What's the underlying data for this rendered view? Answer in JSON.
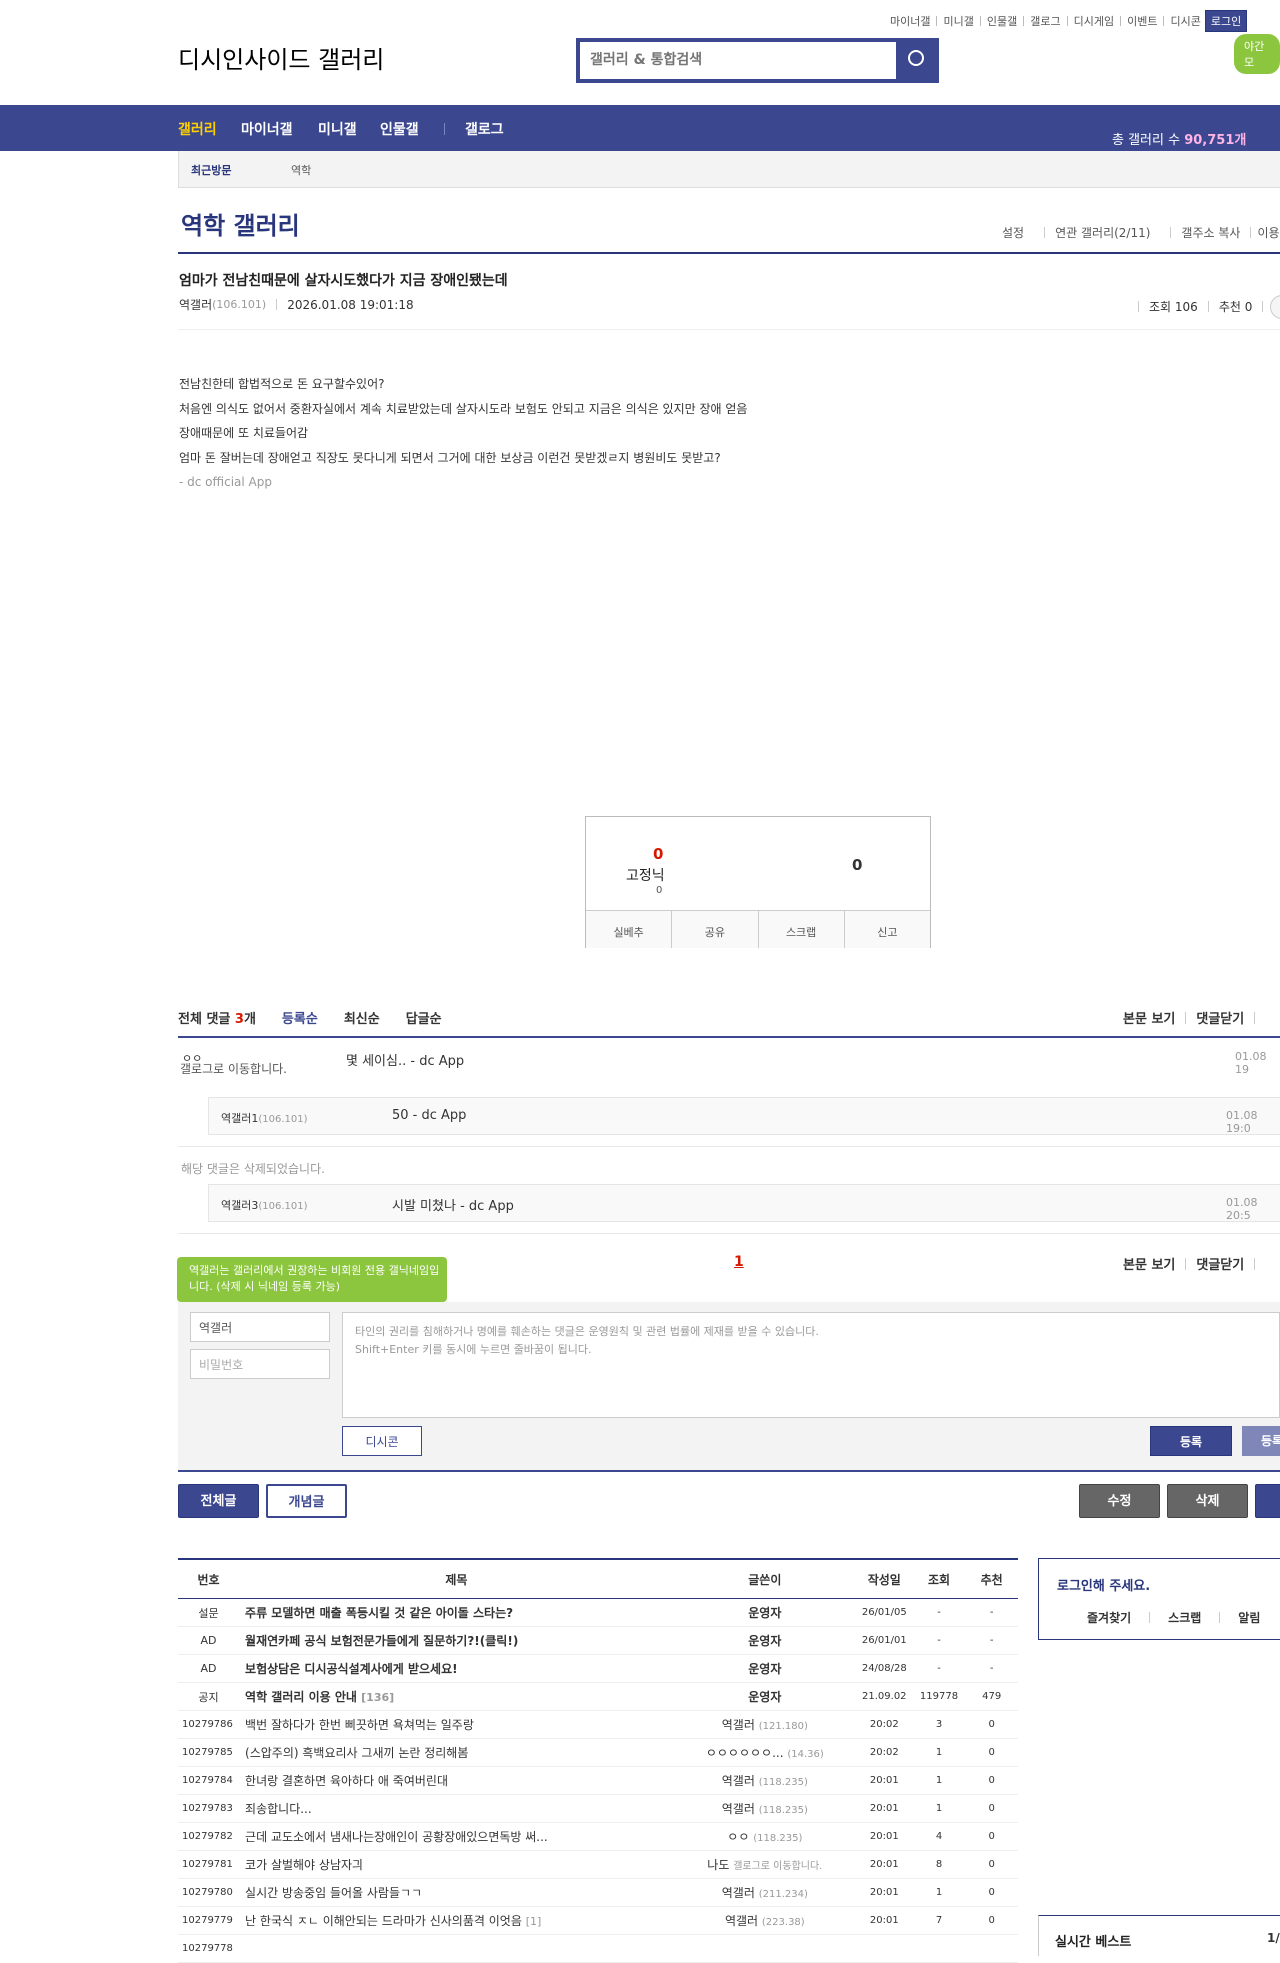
{
  "header": {
    "util_links": [
      "마이너갤",
      "미니갤",
      "인물갤",
      "갤로그",
      "디시게임",
      "이벤트",
      "디시콘"
    ],
    "login": "로그인",
    "night_mode": "야간 모",
    "logo_alt": "디시인사이드 갤러리",
    "search_placeholder": "갤러리 & 통합검색"
  },
  "nav": {
    "items": [
      "갤러리",
      "마이너갤",
      "미니갤",
      "인물갤",
      "갤로그"
    ],
    "count_label": "총 갤러리 수",
    "count_value": "90,751개"
  },
  "recent": {
    "label": "최근방문",
    "gallery": "역학"
  },
  "gallery": {
    "title": "역학 갤러리",
    "tools": [
      "설정",
      "연관 갤러리(2/11)",
      "갤주소 복사",
      "이용"
    ]
  },
  "post": {
    "title": "엄마가 전남친때문에 살자시도했다가 지금 장애인됐는데",
    "author": "역갤러",
    "ip": "(106.101)",
    "date": "2026.01.08 19:01:18",
    "views": "조회 106",
    "recommend": "추천 0",
    "body": [
      "전남친한테 합법적으로 돈 요구할수있어?",
      "처음엔 의식도 없어서 중환자실에서 계속 치료받았는데 살자시도라 보험도 안되고 지금은 의식은 있지만 장애 얻음",
      "장애때문에 또 치료들어감",
      "엄마 돈 잘버는데 장애얻고 직장도 못다니게 되면서 그거에 대한 보상금 이런건 못받겠ㄹ지 병원비도 못받고?"
    ],
    "signature": "- dc official App"
  },
  "recommend_box": {
    "up": "0",
    "fixed_nick": "고정닉",
    "fixed_count": "0",
    "down": "0",
    "buttons": [
      "실베추",
      "공유",
      "스크랩",
      "신고"
    ]
  },
  "comments": {
    "total_label": "전체 댓글",
    "total_count": "3",
    "total_unit": "개",
    "sort_tabs": [
      "등록순",
      "최신순",
      "답글순"
    ],
    "view_body": "본문 보기",
    "close": "댓글닫기",
    "items": [
      {
        "nick": "ㅇㅇ",
        "gallog": "갤로그로 이동합니다.",
        "text": "몇 세이심.. - dc App",
        "date": "01.08 19"
      },
      {
        "nick": "역갤러1",
        "ip": "(106.101)",
        "text": "50 - dc App",
        "date": "01.08 19:0"
      },
      {
        "deleted": "해당 댓글은 삭제되었습니다."
      },
      {
        "nick": "역갤러3",
        "ip": "(106.101)",
        "text": "시발 미쳤나 - dc App",
        "date": "01.08 20:5"
      }
    ],
    "page": "1"
  },
  "write": {
    "tooltip": "역갤러는 갤러리에서 권장하는 비회원 전용 갤닉네임입니다. (삭제 시 닉네임 등록 가능)",
    "nick": "역갤러",
    "password_placeholder": "비밀번호",
    "memo_placeholder_1": "타인의 권리를 침해하거나 명예를 훼손하는 댓글은 운영원칙 및 관련 법률에 제재를 받을 수 있습니다.",
    "memo_placeholder_2": "Shift+Enter 키를 동시에 누르면 줄바꿈이 됩니다.",
    "dccon": "디시콘",
    "submit": "등록",
    "submit2": "등록"
  },
  "post_buttons": {
    "all": "전체글",
    "concept": "개념글",
    "edit": "수정",
    "delete": "삭제"
  },
  "list": {
    "headers": [
      "번호",
      "제목",
      "글쓴이",
      "작성일",
      "조회",
      "추천"
    ],
    "rows": [
      {
        "no": "설문",
        "title": "주류 모델하면 매출 폭등시킬 것 같은 아이돌 스타는?",
        "writer": "운영자",
        "ip": "",
        "date": "26/01/05",
        "views": "-",
        "rec": "-",
        "bold": true
      },
      {
        "no": "AD",
        "title": "월재연카페 공식 보험전문가들에게 질문하기?!(클릭!)",
        "writer": "운영자",
        "ip": "",
        "date": "26/01/01",
        "views": "-",
        "rec": "-",
        "bold": true
      },
      {
        "no": "AD",
        "title": "보험상담은 디시공식설계사에게 받으세요!",
        "writer": "운영자",
        "ip": "",
        "date": "24/08/28",
        "views": "-",
        "rec": "-",
        "bold": true
      },
      {
        "no": "공지",
        "title": "역학 갤러리 이용 안내",
        "rc": "[136]",
        "writer": "운영자",
        "ip": "",
        "date": "21.09.02",
        "views": "119778",
        "rec": "479",
        "bold": true
      },
      {
        "no": "10279786",
        "title": "백번 잘하다가 한번 삐끗하면 욕쳐먹는 일주랑",
        "writer": "역갤러",
        "ip": "(121.180)",
        "date": "20:02",
        "views": "3",
        "rec": "0"
      },
      {
        "no": "10279785",
        "title": "(스압주의) 흑백요리사 그새끼 논란 정리해봄",
        "writer": "ㅇㅇㅇㅇㅇㅇ...",
        "ip": "(14.36)",
        "date": "20:02",
        "views": "1",
        "rec": "0"
      },
      {
        "no": "10279784",
        "title": "한녀랑 결혼하면 육아하다 애 죽여버린대",
        "writer": "역갤러",
        "ip": "(118.235)",
        "date": "20:01",
        "views": "1",
        "rec": "0"
      },
      {
        "no": "10279783",
        "title": "죄송합니다...",
        "writer": "역갤러",
        "ip": "(118.235)",
        "date": "20:01",
        "views": "1",
        "rec": "0"
      },
      {
        "no": "10279782",
        "title": "근데 교도소에서 냄새나는장애인이 공황장애있으면독방 써...",
        "writer": "ㅇㅇ",
        "ip": "(118.235)",
        "date": "20:01",
        "views": "4",
        "rec": "0"
      },
      {
        "no": "10279781",
        "title": "코가 살벌해야 상남자긔",
        "writer": "나도",
        "ip": "갤로그로 이동합니다.",
        "date": "20:01",
        "views": "8",
        "rec": "0"
      },
      {
        "no": "10279780",
        "title": "실시간 방송중임 들어올 사람들ㄱㄱ",
        "writer": "역갤러",
        "ip": "(211.234)",
        "date": "20:01",
        "views": "1",
        "rec": "0"
      },
      {
        "no": "10279779",
        "title": "난 한국식 ㅈㄴ 이해안되는 드라마가 신사의품격 이엇음",
        "rc": "[1]",
        "writer": "역갤러",
        "ip": "(223.38)",
        "date": "20:01",
        "views": "7",
        "rec": "0"
      },
      {
        "no": "10279778",
        "title": "",
        "writer": "",
        "ip": "",
        "date": "",
        "views": "",
        "rec": ""
      }
    ]
  },
  "side": {
    "login_prompt": "로그인해 주세요.",
    "links": [
      "즐겨찾기",
      "스크랩",
      "알림"
    ],
    "best_title": "실시간 베스트",
    "best_page": "1/"
  }
}
